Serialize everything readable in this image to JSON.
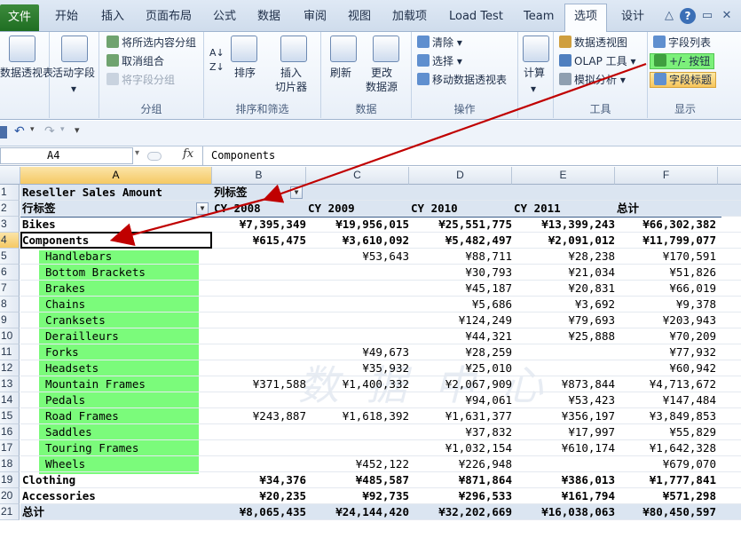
{
  "tabs": {
    "file": "文件",
    "items": [
      "开始",
      "插入",
      "页面布局",
      "公式",
      "数据",
      "审阅",
      "视图",
      "加载项",
      "Load Test",
      "Team",
      "选项",
      "设计"
    ],
    "active": "选项"
  },
  "ribbon": {
    "pivot_table": "数据透视表",
    "active_field": "活动字段",
    "group_selection": "将所选内容分组",
    "ungroup": "取消组合",
    "group_field": "将字段分组",
    "group_label_group": "分组",
    "sort": "排序",
    "insert_slicer": "插入\n切片器",
    "group_label_sort": "排序和筛选",
    "refresh": "刷新",
    "change_source": "更改\n数据源",
    "group_label_data": "数据",
    "clear": "清除",
    "select": "选择",
    "move_pivot": "移动数据透视表",
    "group_label_actions": "操作",
    "calculate": "计算",
    "pivot_chart": "数据透视图",
    "olap_tools": "OLAP 工具",
    "what_if": "模拟分析",
    "group_label_tools": "工具",
    "field_list": "字段列表",
    "plus_minus_buttons": "+/- 按钮",
    "field_headers": "字段标题",
    "group_label_show": "显示"
  },
  "formula_bar": {
    "name_box": "A4",
    "fx": "fx",
    "content": "Components"
  },
  "columns": [
    "A",
    "B",
    "C",
    "D",
    "E",
    "F"
  ],
  "selected_column": "A",
  "selected_row": "4",
  "watermark": "数 据 中 心",
  "sheet": {
    "r1": {
      "a": "Reseller Sales Amount",
      "b": "列标签"
    },
    "r2": {
      "a": "行标签",
      "b": "CY 2008",
      "c": "CY 2009",
      "d": "CY 2010",
      "e": "CY 2011",
      "f": "总计"
    },
    "rows": [
      {
        "num": "3",
        "label": "Bikes",
        "b": "¥7,395,349",
        "c": "¥19,956,015",
        "d": "¥25,551,775",
        "e": "¥13,399,243",
        "f": "¥66,302,382",
        "bold": true,
        "indent": false
      },
      {
        "num": "4",
        "label": "Components",
        "b": "¥615,475",
        "c": "¥3,610,092",
        "d": "¥5,482,497",
        "e": "¥2,091,012",
        "f": "¥11,799,077",
        "bold": true,
        "indent": false
      },
      {
        "num": "5",
        "label": "Handlebars",
        "b": "",
        "c": "¥53,643",
        "d": "¥88,711",
        "e": "¥28,238",
        "f": "¥170,591",
        "bold": false,
        "indent": true
      },
      {
        "num": "6",
        "label": "Bottom Brackets",
        "b": "",
        "c": "",
        "d": "¥30,793",
        "e": "¥21,034",
        "f": "¥51,826",
        "bold": false,
        "indent": true
      },
      {
        "num": "7",
        "label": "Brakes",
        "b": "",
        "c": "",
        "d": "¥45,187",
        "e": "¥20,831",
        "f": "¥66,019",
        "bold": false,
        "indent": true
      },
      {
        "num": "8",
        "label": "Chains",
        "b": "",
        "c": "",
        "d": "¥5,686",
        "e": "¥3,692",
        "f": "¥9,378",
        "bold": false,
        "indent": true
      },
      {
        "num": "9",
        "label": "Cranksets",
        "b": "",
        "c": "",
        "d": "¥124,249",
        "e": "¥79,693",
        "f": "¥203,943",
        "bold": false,
        "indent": true
      },
      {
        "num": "10",
        "label": "Derailleurs",
        "b": "",
        "c": "",
        "d": "¥44,321",
        "e": "¥25,888",
        "f": "¥70,209",
        "bold": false,
        "indent": true
      },
      {
        "num": "11",
        "label": "Forks",
        "b": "",
        "c": "¥49,673",
        "d": "¥28,259",
        "e": "",
        "f": "¥77,932",
        "bold": false,
        "indent": true
      },
      {
        "num": "12",
        "label": "Headsets",
        "b": "",
        "c": "¥35,932",
        "d": "¥25,010",
        "e": "",
        "f": "¥60,942",
        "bold": false,
        "indent": true
      },
      {
        "num": "13",
        "label": "Mountain Frames",
        "b": "¥371,588",
        "c": "¥1,400,332",
        "d": "¥2,067,909",
        "e": "¥873,844",
        "f": "¥4,713,672",
        "bold": false,
        "indent": true
      },
      {
        "num": "14",
        "label": "Pedals",
        "b": "",
        "c": "",
        "d": "¥94,061",
        "e": "¥53,423",
        "f": "¥147,484",
        "bold": false,
        "indent": true
      },
      {
        "num": "15",
        "label": "Road Frames",
        "b": "¥243,887",
        "c": "¥1,618,392",
        "d": "¥1,631,377",
        "e": "¥356,197",
        "f": "¥3,849,853",
        "bold": false,
        "indent": true
      },
      {
        "num": "16",
        "label": "Saddles",
        "b": "",
        "c": "",
        "d": "¥37,832",
        "e": "¥17,997",
        "f": "¥55,829",
        "bold": false,
        "indent": true
      },
      {
        "num": "17",
        "label": "Touring Frames",
        "b": "",
        "c": "",
        "d": "¥1,032,154",
        "e": "¥610,174",
        "f": "¥1,642,328",
        "bold": false,
        "indent": true
      },
      {
        "num": "18",
        "label": "Wheels",
        "b": "",
        "c": "¥452,122",
        "d": "¥226,948",
        "e": "",
        "f": "¥679,070",
        "bold": false,
        "indent": true
      },
      {
        "num": "19",
        "label": "Clothing",
        "b": "¥34,376",
        "c": "¥485,587",
        "d": "¥871,864",
        "e": "¥386,013",
        "f": "¥1,777,841",
        "bold": true,
        "indent": false
      },
      {
        "num": "20",
        "label": "Accessories",
        "b": "¥20,235",
        "c": "¥92,735",
        "d": "¥296,533",
        "e": "¥161,794",
        "f": "¥571,298",
        "bold": true,
        "indent": false
      },
      {
        "num": "21",
        "label": "总计",
        "b": "¥8,065,435",
        "c": "¥24,144,420",
        "d": "¥32,202,669",
        "e": "¥16,038,063",
        "f": "¥80,450,597",
        "bold": true,
        "indent": false
      }
    ]
  },
  "colors": {
    "highlight_green": "#7cf07a",
    "arrow": "#c00000",
    "band": "#dbe5f1"
  }
}
